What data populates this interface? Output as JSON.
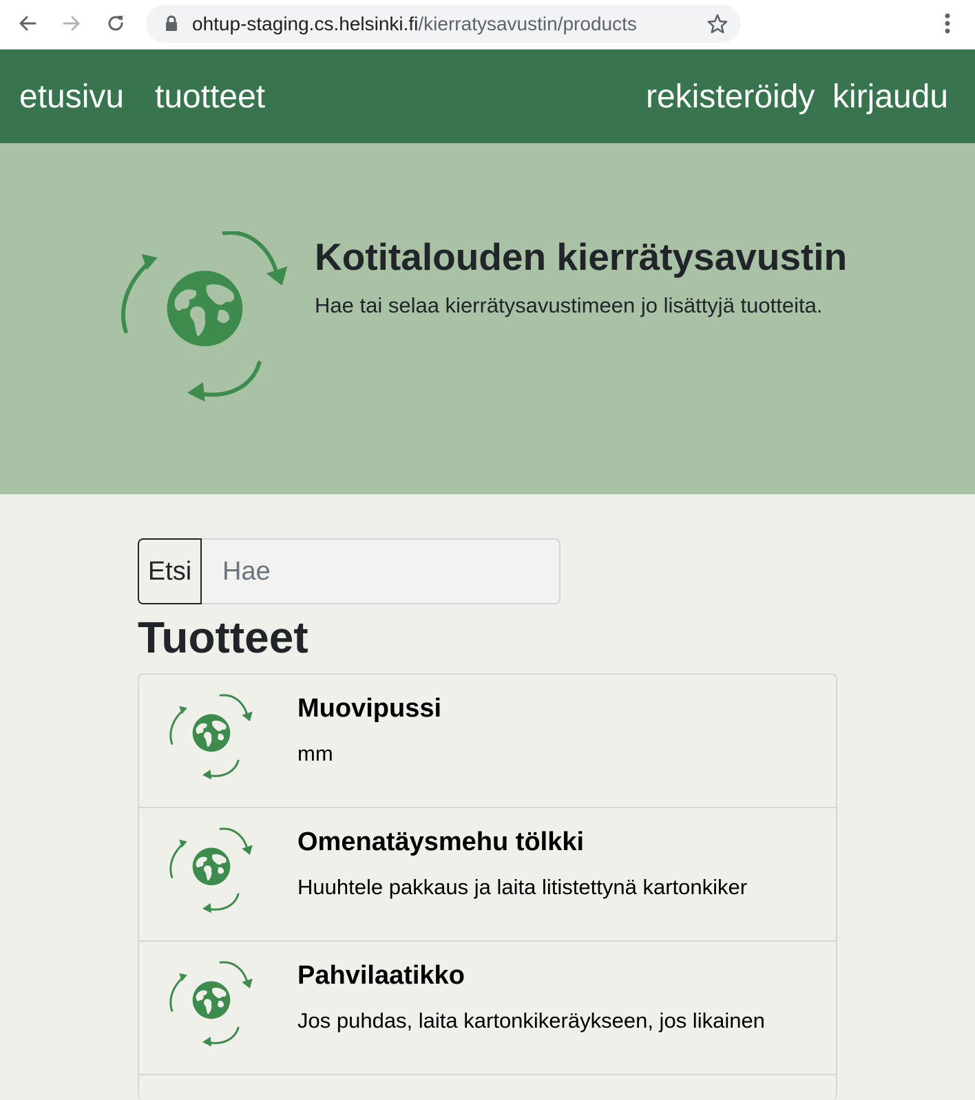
{
  "browser": {
    "url_domain": "ohtup-staging.cs.helsinki.fi",
    "url_path": "/kierratysavustin/products"
  },
  "navbar": {
    "left_links": [
      "etusivu",
      "tuotteet"
    ],
    "right_links": [
      "rekisteröidy",
      "kirjaudu"
    ],
    "background": "#38754f"
  },
  "hero": {
    "title": "Kotitalouden kierrätysavustin",
    "subtitle": "Hae tai selaa kierrätysavustimeen jo lisättyjä tuotteita.",
    "logo_icon": "recycle-globe-icon",
    "background": "#a9c2a6"
  },
  "search": {
    "button_label": "Etsi",
    "placeholder": "Hae",
    "value": ""
  },
  "products_section": {
    "title": "Tuotteet",
    "items": [
      {
        "name": "Muovipussi",
        "description": "mm"
      },
      {
        "name": "Omenatäysmehu tölkki",
        "description": "Huuhtele pakkaus ja laita litistettynä kartonkiker"
      },
      {
        "name": "Pahvilaatikko",
        "description": "Jos puhdas, laita kartonkikeräykseen, jos likainen"
      }
    ]
  },
  "colors": {
    "accent_green": "#3d8b4d",
    "page_background": "#f0f0eb"
  }
}
